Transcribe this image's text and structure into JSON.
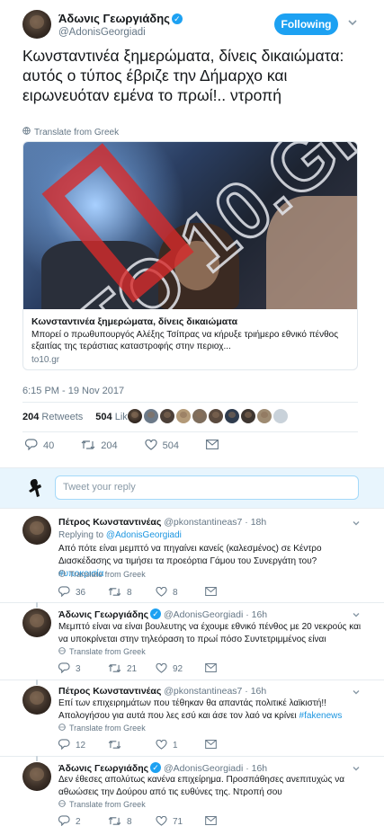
{
  "main_tweet": {
    "display_name": "Άδωνις Γεωργιάδης",
    "handle": "@AdonisGeorgiadi",
    "follow_label": "Following",
    "text": "Κωνσταντινέα ξημερώματα, δίνεις δικαιώματα: αυτός ο τύπος έβριζε την Δήμαρχο και ειρωνευόταν εμένα το πρωί!.. ντροπή",
    "translate_label": "Translate from Greek",
    "card": {
      "image_text": "TO 10.GR",
      "title": "Κωνσταντινέα ξημερώματα, δίνεις δικαιώματα",
      "description": "Μπορεί ο πρωθυπουργός Αλέξης Τσίπρας να κήρυξε τριήμερο εθνικό πένθος εξαιτίας της τεράστιας καταστροφής στην περιοχ...",
      "domain": "to10.gr"
    },
    "timestamp": "6:15 PM - 19 Nov 2017",
    "retweets_count": "204",
    "retweets_label": "Retweets",
    "likes_count": "504",
    "likes_label": "Likes",
    "actions": {
      "replies": "40",
      "retweets": "204",
      "likes": "504"
    }
  },
  "reply_box": {
    "placeholder": "Tweet your reply"
  },
  "replies": [
    {
      "name": "Πέτρος Κωνσταντινέας",
      "verified": false,
      "handle": "@pkonstantineas7",
      "time": "· 18h",
      "replying_prefix": "Replying to",
      "replying_to": "@AdonisGeorgiadi",
      "text_line1": "Από πότε είναι μεμπτό να πηγαίνει κανείς  (καλεσμένος) σε Κέντρο",
      "text_line2a": "Διασκέδασης να τιμήσει τα προεόρτια Γάμου του Συνεργάτη του? ",
      "hashtag": "#υποκρισία",
      "translate": "Translate from Greek",
      "replies": "36",
      "retweets": "8",
      "likes": "8"
    },
    {
      "name": "Άδωνις Γεωργιάδης",
      "verified": true,
      "handle": "@AdonisGeorgiadi",
      "time": "· 16h",
      "text_line1": "Μεμπτό είναι να είναι βουλευτης να έχουμε εθνικό πένθος με 20 νεκρούς και",
      "text_line2": "να υποκρίνεται στην τηλεόραση το πρωί πόσο Συντετριμμένος είναι",
      "translate": "Translate from Greek",
      "replies": "3",
      "retweets": "21",
      "likes": "92"
    },
    {
      "name": "Πέτρος Κωνσταντινέας",
      "verified": false,
      "handle": "@pkonstantineas7",
      "time": "· 16h",
      "text_line1": "Επί των επιχειρημάτων που τέθηκαν θα απαντάς πολιτικέ λαϊκιστή!!",
      "text_line2a": "Απολογήσου για αυτά που λες εσύ και άσε τον λαό να κρίνει ",
      "hashtag": "#fakenews",
      "translate": "Translate from Greek",
      "replies": "12",
      "retweets": "",
      "likes": "1"
    },
    {
      "name": "Άδωνις Γεωργιάδης",
      "verified": true,
      "handle": "@AdonisGeorgiadi",
      "time": "· 16h",
      "text_line1": "Δεν έθεσες απολύτως κανένα επιχείρημα. Προσπάθησες ανεπιτυχώς να",
      "text_line2": "αθωώσεις την Δούρου από τις ευθύνες της. Ντροπή σου",
      "translate": "Translate from Greek",
      "replies": "2",
      "retweets": "8",
      "likes": "71"
    }
  ],
  "colors": {
    "accent": "#1da1f2",
    "link": "#1b95e0",
    "muted": "#657786",
    "border": "#e6ecf0"
  },
  "icons": [
    "chevron-down-icon",
    "globe-icon",
    "reply-icon",
    "retweet-icon",
    "heart-icon",
    "envelope-icon"
  ]
}
